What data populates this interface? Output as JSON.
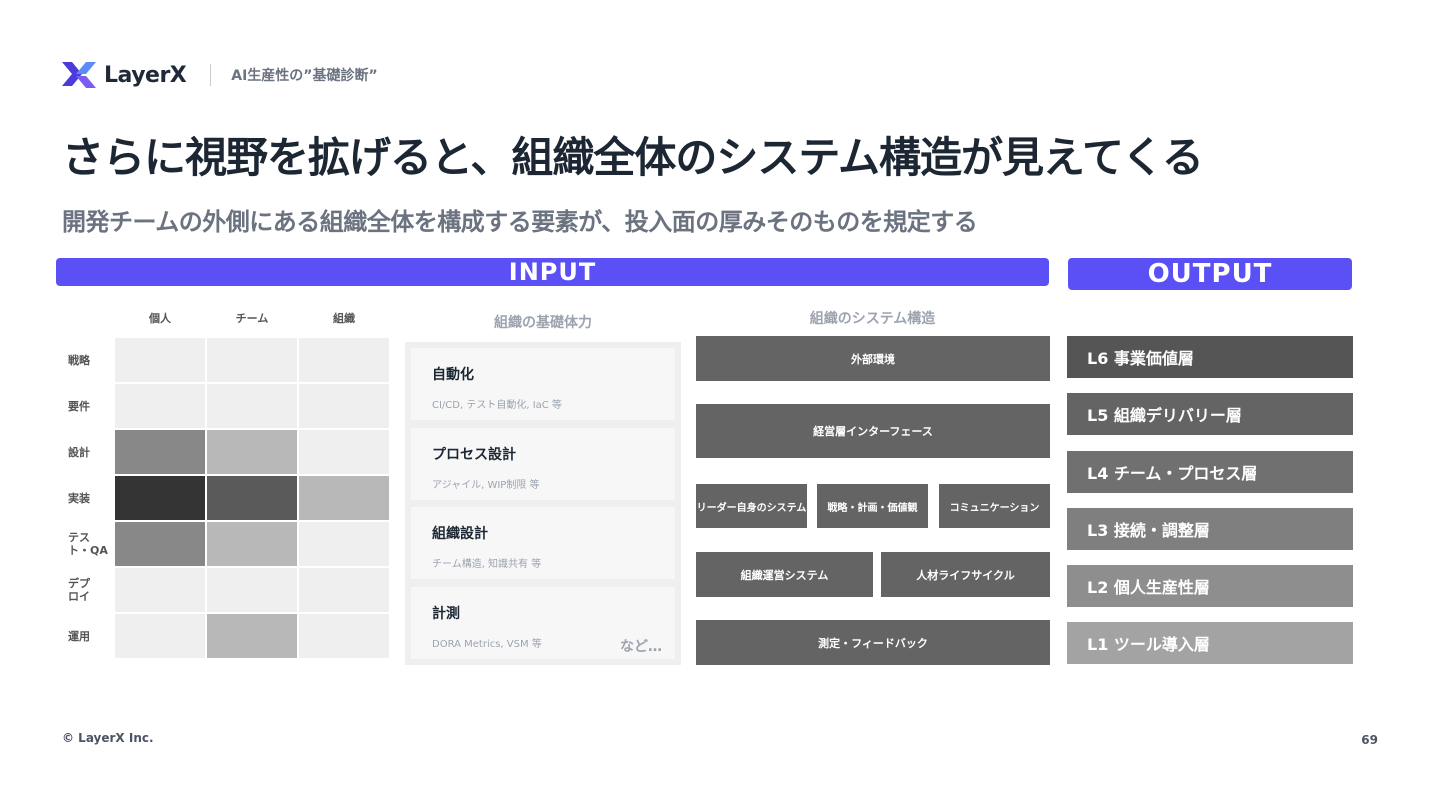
{
  "header": {
    "logo_text": "LayerX",
    "subtitle": "AI生産性の”基礎診断”"
  },
  "title": "さらに視野を拡げると、組織全体のシステム構造が見えてくる",
  "subtitle": "開発チームの外側にある組織全体を構成する要素が、投入面の厚みそのものを規定する",
  "banners": {
    "input": "INPUT",
    "output": "OUTPUT"
  },
  "matrix": {
    "columns": [
      "個人",
      "チーム",
      "組織"
    ],
    "rows": [
      "戦略",
      "要件",
      "設計",
      "実装",
      "テスト・QA",
      "デプロイ",
      "運用"
    ],
    "shades": [
      [
        "#efefef",
        "#efefef",
        "#efefef"
      ],
      [
        "#efefef",
        "#efefef",
        "#efefef"
      ],
      [
        "#888888",
        "#b8b8b8",
        "#efefef"
      ],
      [
        "#333333",
        "#5a5a5a",
        "#b8b8b8"
      ],
      [
        "#888888",
        "#b8b8b8",
        "#efefef"
      ],
      [
        "#efefef",
        "#efefef",
        "#efefef"
      ],
      [
        "#efefef",
        "#b8b8b8",
        "#efefef"
      ]
    ]
  },
  "capabilities": {
    "title": "組織の基礎体力",
    "items": [
      {
        "name": "自動化",
        "desc": "CI/CD, テスト自動化, IaC 等"
      },
      {
        "name": "プロセス設計",
        "desc": "アジャイル, WIP制限 等"
      },
      {
        "name": "組織設計",
        "desc": "チーム構造, 知識共有 等"
      },
      {
        "name": "計測",
        "desc": "DORA Metrics, VSM 等"
      }
    ],
    "etc": "など…"
  },
  "system": {
    "title": "組織のシステム構造",
    "external": "外部環境",
    "management": "経営層インターフェース",
    "leader": "リーダー自身のシステム",
    "strategy": "戦略・計画・価値観",
    "communication": "コミュニケーション",
    "operations": "組織運営システム",
    "talent": "人材ライフサイクル",
    "measurement": "測定・フィードバック"
  },
  "output_layers": [
    {
      "label": "L6 事業価値層",
      "color": "#555555"
    },
    {
      "label": "L5 組織デリバリー層",
      "color": "#646464"
    },
    {
      "label": "L4 チーム・プロセス層",
      "color": "#707070"
    },
    {
      "label": "L3 接続・調整層",
      "color": "#7f7f7f"
    },
    {
      "label": "L2 個人生産性層",
      "color": "#8e8e8e"
    },
    {
      "label": "L1 ツール導入層",
      "color": "#a3a3a3"
    }
  ],
  "colors": {
    "accent": "#5a50f5",
    "title": "#1c2733",
    "muted": "#6b7280"
  },
  "footer": {
    "copyright": "© LayerX Inc.",
    "page": "69"
  }
}
